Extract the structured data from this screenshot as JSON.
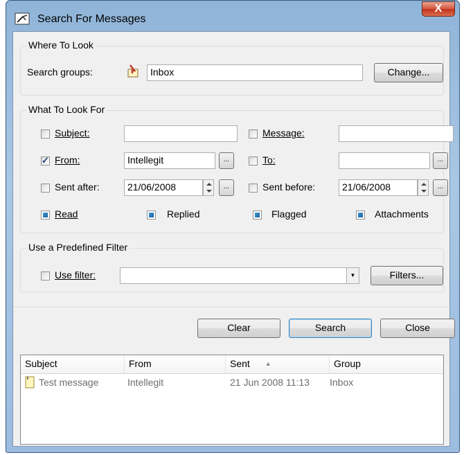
{
  "window": {
    "title": "Search For Messages",
    "close_symbol": "X"
  },
  "where": {
    "title": "Where To Look",
    "search_groups_label": "Search groups:",
    "groups_value": "Inbox",
    "change_label": "Change..."
  },
  "what": {
    "title": "What To Look For",
    "subject_label": "Subject:",
    "subject_value": "",
    "message_label": "Message:",
    "message_value": "",
    "from_label": "From:",
    "from_value": "Intellegit",
    "from_checked": true,
    "to_label": "To:",
    "to_value": "",
    "sent_after_label": "Sent after:",
    "sent_after_value": "21/06/2008",
    "sent_before_label": "Sent before:",
    "sent_before_value": "21/06/2008",
    "browse_label": "...",
    "read_label": "Read",
    "replied_label": "Replied",
    "flagged_label": "Flagged",
    "attachments_label": "Attachments"
  },
  "filter": {
    "title": "Use a Predefined Filter",
    "use_filter_label": "Use filter:",
    "filter_value": "",
    "filters_button": "Filters..."
  },
  "buttons": {
    "clear": "Clear",
    "search": "Search",
    "close": "Close"
  },
  "results": {
    "columns": [
      "Subject",
      "From",
      "Sent",
      "Group"
    ],
    "sort_indicator": "▲",
    "rows": [
      {
        "subject": "Test message",
        "from": "Intellegit",
        "sent": "21 Jun 2008 11:13",
        "group": "Inbox"
      }
    ]
  }
}
